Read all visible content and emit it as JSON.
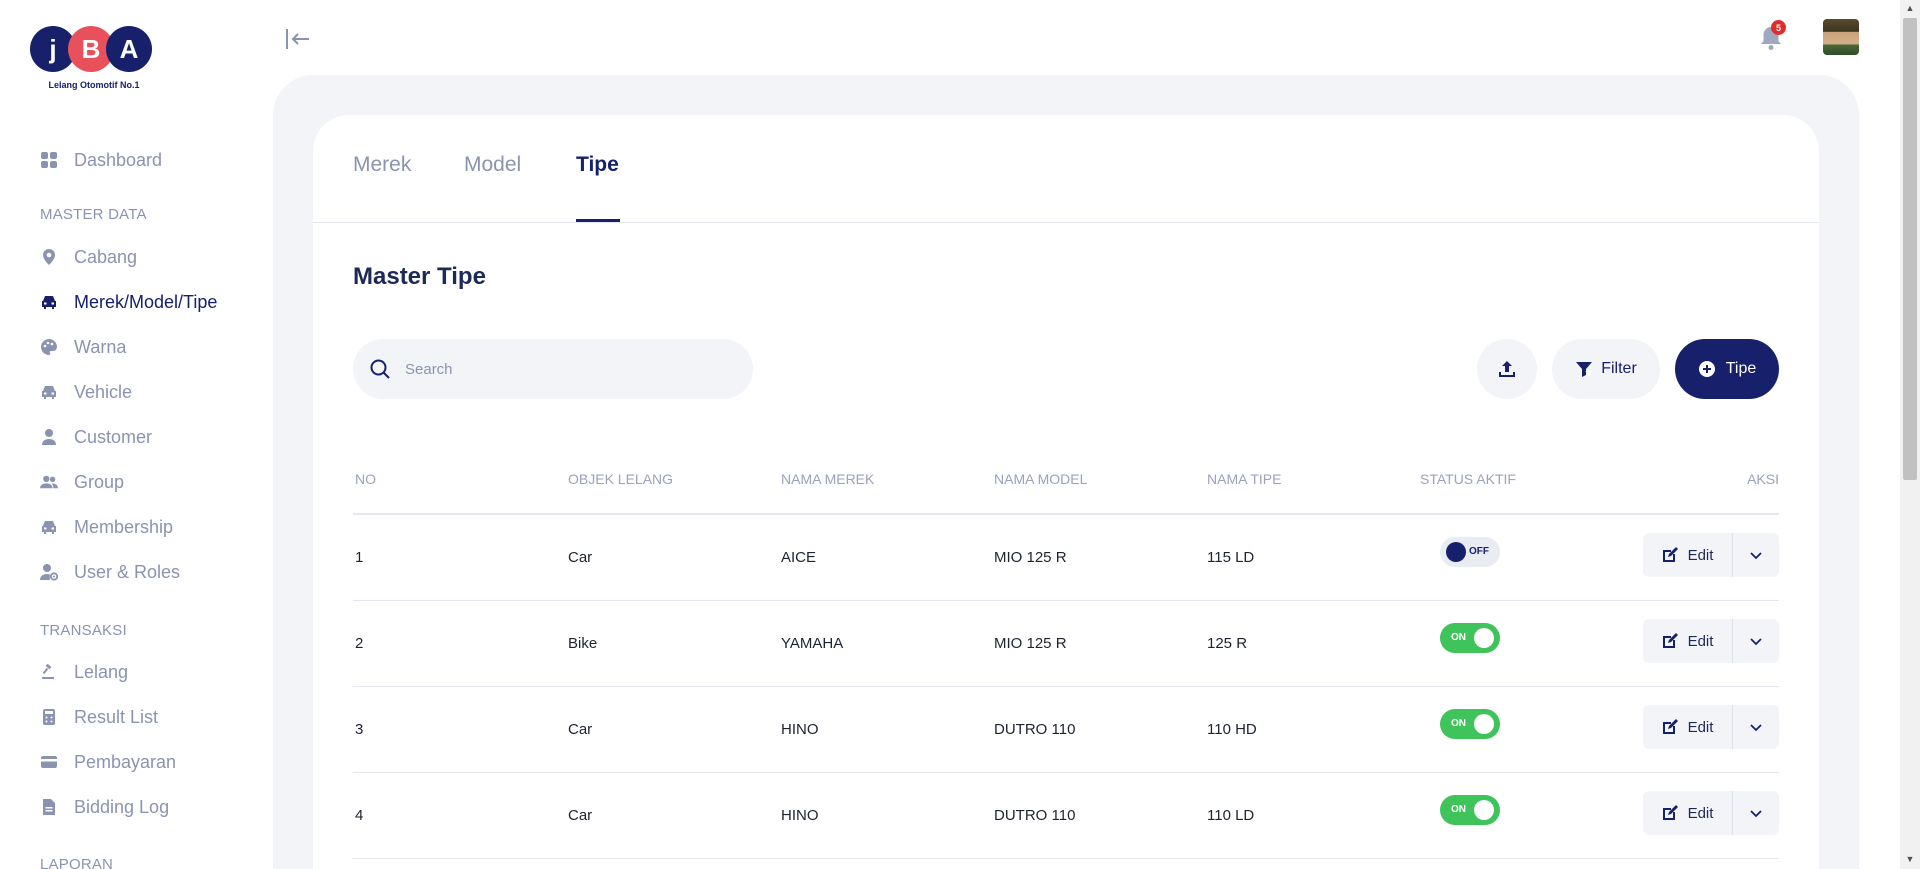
{
  "brand": {
    "letters": [
      "j",
      "B",
      "A"
    ],
    "tagline": "Lelang Otomotif No.1"
  },
  "sidebar": {
    "dashboard": "Dashboard",
    "master_title": "MASTER DATA",
    "master_items": [
      "Cabang",
      "Merek/Model/Tipe",
      "Warna",
      "Vehicle",
      "Customer",
      "Group",
      "Membership",
      "User & Roles"
    ],
    "transaksi_title": "TRANSAKSI",
    "transaksi_items": [
      "Lelang",
      "Result List",
      "Pembayaran",
      "Bidding Log"
    ],
    "laporan_title": "LAPORAN",
    "active": "Merek/Model/Tipe"
  },
  "topbar": {
    "notification_count": "5"
  },
  "tabs": [
    "Merek",
    "Model",
    "Tipe"
  ],
  "active_tab": "Tipe",
  "page_title": "Master Tipe",
  "search": {
    "placeholder": "Search",
    "value": ""
  },
  "buttons": {
    "filter": "Filter",
    "add": "Tipe"
  },
  "table": {
    "columns": [
      "NO",
      "OBJEK LELANG",
      "NAMA MEREK",
      "NAMA MODEL",
      "NAMA TIPE",
      "STATUS AKTIF",
      "AKSI"
    ],
    "rows": [
      {
        "no": "1",
        "objek": "Car",
        "merek": "AICE",
        "model": "MIO 125 R",
        "tipe": "115 LD",
        "status": "OFF"
      },
      {
        "no": "2",
        "objek": "Bike",
        "merek": "YAMAHA",
        "model": "MIO 125 R",
        "tipe": "125 R",
        "status": "ON"
      },
      {
        "no": "3",
        "objek": "Car",
        "merek": "HINO",
        "model": "DUTRO 110",
        "tipe": "110 HD",
        "status": "ON"
      },
      {
        "no": "4",
        "objek": "Car",
        "merek": "HINO",
        "model": "DUTRO 110",
        "tipe": "110 LD",
        "status": "ON"
      }
    ],
    "edit_label": "Edit"
  },
  "colors": {
    "primary": "#16206b",
    "accent_red": "#e8505b",
    "toggle_on": "#3ec45a",
    "muted": "#8a94b1",
    "surface": "#f3f4f7"
  }
}
